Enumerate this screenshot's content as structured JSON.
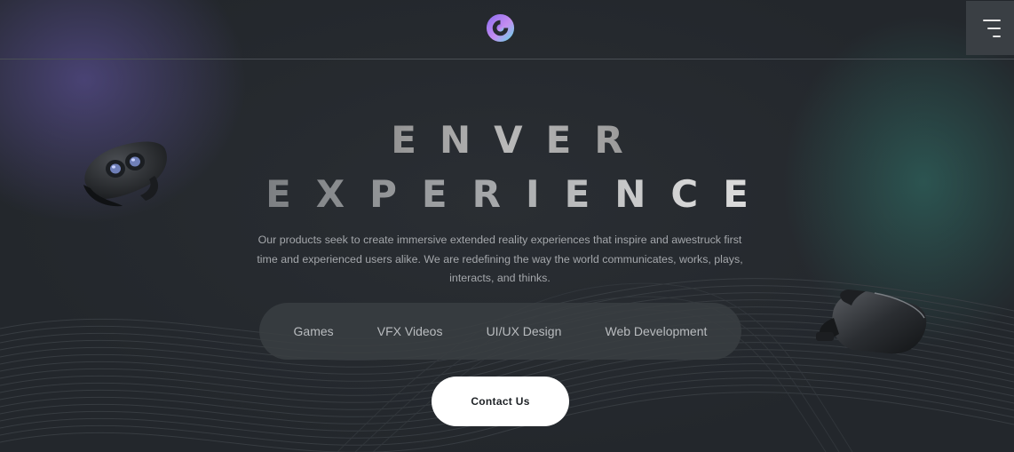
{
  "header": {
    "logo_icon": "brand-logo-icon",
    "menu_icon": "hamburger-menu-icon"
  },
  "hero": {
    "title_line1": "ENVER",
    "title_line2": "EXPERIENCE",
    "description": "Our products seek to create immersive extended reality experiences that inspire and awestruck first time and experienced users alike. We are redefining the way the world communicates, works, plays, interacts, and thinks."
  },
  "services": {
    "tabs": [
      {
        "label": "Games"
      },
      {
        "label": "VFX Videos"
      },
      {
        "label": "UI/UX Design"
      },
      {
        "label": "Web Development"
      }
    ]
  },
  "cta": {
    "label": "Contact Us"
  },
  "colors": {
    "background": "#23272c",
    "accent_purple": "#564c8c",
    "accent_teal": "#32786e",
    "logo_gradient_start": "#8a6cf0",
    "logo_gradient_end": "#5ee0e8",
    "button_bg": "#ffffff"
  },
  "decor": {
    "left_image": "vr-headset-image",
    "right_image": "vr-headset-image"
  }
}
